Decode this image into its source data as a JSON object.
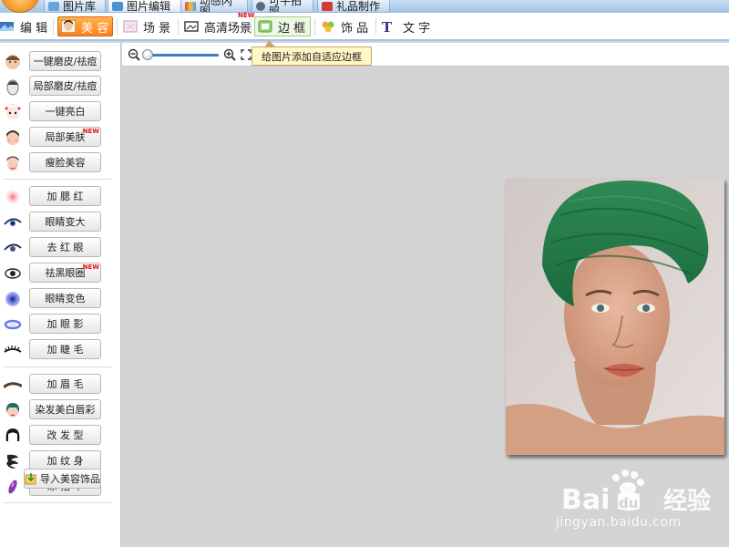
{
  "top_tabs": [
    {
      "label": "图片库",
      "icon": "image-library-icon"
    },
    {
      "label": "图片编辑",
      "icon": "image-edit-icon",
      "active": true
    },
    {
      "label": "动感闪图",
      "icon": "flash-animation-icon"
    },
    {
      "label": "可牛拍照",
      "icon": "camera-icon"
    },
    {
      "label": "礼品制作",
      "icon": "gift-icon"
    }
  ],
  "tool_tabs": [
    {
      "label": "编 辑",
      "icon": "edit-icon"
    },
    {
      "label": "美 容",
      "icon": "beauty-face-icon",
      "active": true
    },
    {
      "label": "场 景",
      "icon": "scene-icon"
    },
    {
      "label": "高清场景",
      "icon": "hd-scene-icon",
      "badge": "NEW"
    },
    {
      "label": "边 框",
      "icon": "frame-icon",
      "hovered": true
    },
    {
      "label": "饰 品",
      "icon": "ornament-icon"
    },
    {
      "label": "文 字",
      "icon": "text-icon"
    }
  ],
  "tooltip": {
    "text": "给图片添加自适应边框"
  },
  "left_tools": [
    {
      "label": "一键磨皮/祛痘",
      "icon": "face-smooth-icon"
    },
    {
      "label": "局部磨皮/祛痘",
      "icon": "face-grey-icon"
    },
    {
      "label": "一键亮白",
      "icon": "opera-face-icon"
    },
    {
      "label": "局部美肤",
      "icon": "skin-face-icon",
      "badge": "NEW"
    },
    {
      "label": "瘦脸美容",
      "icon": "slim-face-icon"
    },
    {
      "label": "加 腮 红",
      "icon": "blush-icon"
    },
    {
      "label": "眼睛变大",
      "icon": "eye-enlarge-icon"
    },
    {
      "label": "去 红 眼",
      "icon": "red-eye-icon"
    },
    {
      "label": "祛黑眼圈",
      "icon": "dark-circle-icon",
      "badge": "NEW"
    },
    {
      "label": "眼睛变色",
      "icon": "eye-color-icon"
    },
    {
      "label": "加 眼 影",
      "icon": "eye-shadow-icon"
    },
    {
      "label": "加 睫 毛",
      "icon": "eyelash-icon"
    },
    {
      "label": "加 眉 毛",
      "icon": "eyebrow-icon"
    },
    {
      "label": "染发美白唇彩",
      "icon": "hair-dye-icon"
    },
    {
      "label": "改 发 型",
      "icon": "hairstyle-icon"
    },
    {
      "label": "加 纹 身",
      "icon": "tattoo-icon"
    },
    {
      "label": "涂 指 甲",
      "icon": "nail-polish-icon"
    }
  ],
  "import_button": {
    "label": "导入美容饰品",
    "icon": "import-ornament-icon"
  },
  "canvas_toolbar": {
    "zoom_level": 0.0
  },
  "watermark": {
    "brand": "Baidu经验",
    "url": "jingyan.baidu.com"
  },
  "colors": {
    "accent_orange": "#ff8a24",
    "tab_blue": "#9cc4ec",
    "canvas_bg": "#d4d4d4",
    "badge_red": "#e01010"
  }
}
